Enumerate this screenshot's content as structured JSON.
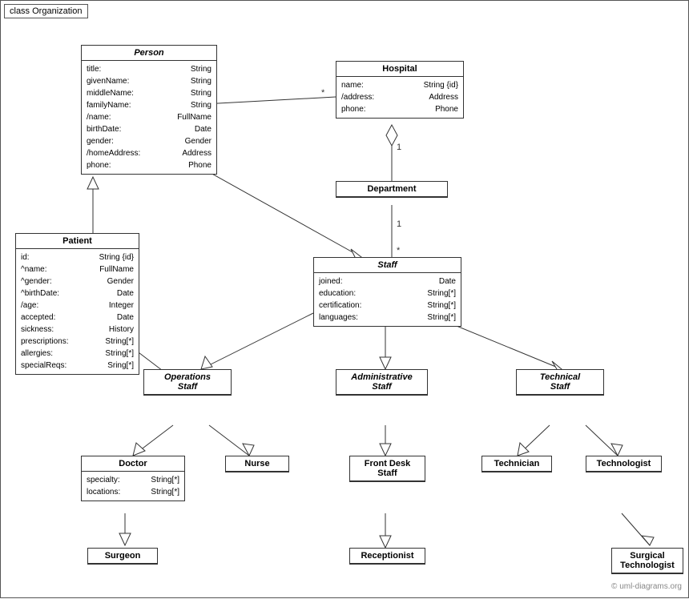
{
  "diagram": {
    "title": "class Organization",
    "classes": {
      "person": {
        "name": "Person",
        "italic": true,
        "attrs": [
          {
            "name": "title:",
            "type": "String"
          },
          {
            "name": "givenName:",
            "type": "String"
          },
          {
            "name": "middleName:",
            "type": "String"
          },
          {
            "name": "familyName:",
            "type": "String"
          },
          {
            "name": "/name:",
            "type": "FullName"
          },
          {
            "name": "birthDate:",
            "type": "Date"
          },
          {
            "name": "gender:",
            "type": "Gender"
          },
          {
            "name": "/homeAddress:",
            "type": "Address"
          },
          {
            "name": "phone:",
            "type": "Phone"
          }
        ]
      },
      "hospital": {
        "name": "Hospital",
        "italic": false,
        "attrs": [
          {
            "name": "name:",
            "type": "String {id}"
          },
          {
            "name": "/address:",
            "type": "Address"
          },
          {
            "name": "phone:",
            "type": "Phone"
          }
        ]
      },
      "department": {
        "name": "Department",
        "italic": false,
        "attrs": []
      },
      "staff": {
        "name": "Staff",
        "italic": true,
        "attrs": [
          {
            "name": "joined:",
            "type": "Date"
          },
          {
            "name": "education:",
            "type": "String[*]"
          },
          {
            "name": "certification:",
            "type": "String[*]"
          },
          {
            "name": "languages:",
            "type": "String[*]"
          }
        ]
      },
      "patient": {
        "name": "Patient",
        "italic": false,
        "attrs": [
          {
            "name": "id:",
            "type": "String {id}"
          },
          {
            "name": "^name:",
            "type": "FullName"
          },
          {
            "name": "^gender:",
            "type": "Gender"
          },
          {
            "name": "^birthDate:",
            "type": "Date"
          },
          {
            "name": "/age:",
            "type": "Integer"
          },
          {
            "name": "accepted:",
            "type": "Date"
          },
          {
            "name": "sickness:",
            "type": "History"
          },
          {
            "name": "prescriptions:",
            "type": "String[*]"
          },
          {
            "name": "allergies:",
            "type": "String[*]"
          },
          {
            "name": "specialReqs:",
            "type": "Sring[*]"
          }
        ]
      },
      "operationsStaff": {
        "name": "Operations Staff",
        "italic": true,
        "multiline": true
      },
      "administrativeStaff": {
        "name": "Administrative Staff",
        "italic": true,
        "multiline": true
      },
      "technicalStaff": {
        "name": "Technical Staff",
        "italic": true,
        "multiline": true
      },
      "doctor": {
        "name": "Doctor",
        "italic": false,
        "attrs": [
          {
            "name": "specialty:",
            "type": "String[*]"
          },
          {
            "name": "locations:",
            "type": "String[*]"
          }
        ]
      },
      "nurse": {
        "name": "Nurse",
        "italic": false,
        "attrs": []
      },
      "frontDeskStaff": {
        "name": "Front Desk Staff",
        "italic": false,
        "multiline": true,
        "attrs": []
      },
      "technician": {
        "name": "Technician",
        "italic": false,
        "attrs": []
      },
      "technologist": {
        "name": "Technologist",
        "italic": false,
        "attrs": []
      },
      "surgeon": {
        "name": "Surgeon",
        "italic": false,
        "attrs": []
      },
      "receptionist": {
        "name": "Receptionist",
        "italic": false,
        "attrs": []
      },
      "surgicalTechnologist": {
        "name": "Surgical Technologist",
        "italic": false,
        "multiline": true,
        "attrs": []
      }
    },
    "watermark": "© uml-diagrams.org"
  }
}
